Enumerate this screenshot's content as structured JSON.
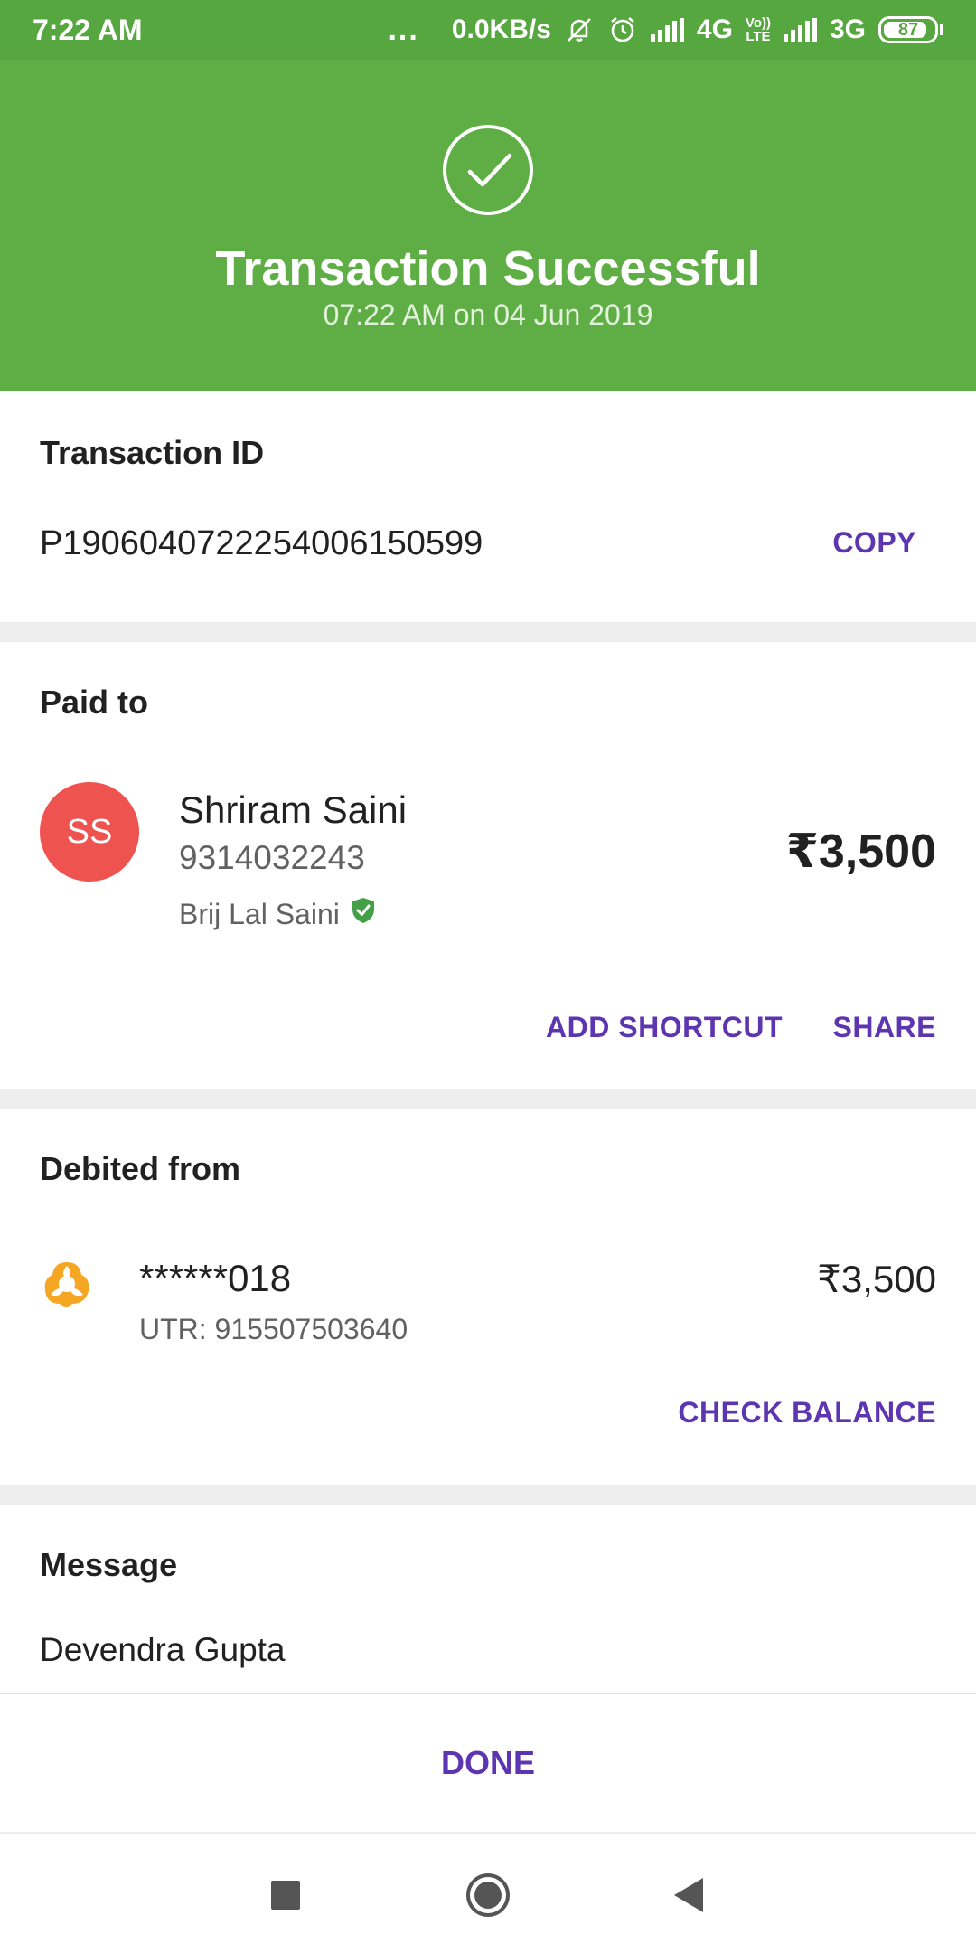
{
  "status_bar": {
    "time": "7:22 AM",
    "dots": "...",
    "speed": "0.0KB/s",
    "net1": "4G",
    "volte_top": "Vo))",
    "volte_bottom": "LTE",
    "net2": "3G",
    "battery": "87"
  },
  "header": {
    "title": "Transaction Successful",
    "subtitle": "07:22 AM on 04 Jun 2019",
    "bg_color": "#5fae45"
  },
  "transaction": {
    "label": "Transaction ID",
    "id": "P1906040722254006150599",
    "copy_label": "COPY"
  },
  "paid_to": {
    "label": "Paid to",
    "avatar_initials": "SS",
    "name": "Shriram Saini",
    "phone": "9314032243",
    "account_name": "Brij Lal Saini",
    "amount": "₹3,500",
    "add_shortcut_label": "ADD SHORTCUT",
    "share_label": "SHARE"
  },
  "debited_from": {
    "label": "Debited from",
    "account": "******018",
    "utr": "UTR: 915507503640",
    "amount": "₹3,500",
    "check_balance_label": "CHECK BALANCE"
  },
  "message": {
    "label": "Message",
    "text": "Devendra Gupta"
  },
  "done_label": "DONE",
  "colors": {
    "accent": "#5e35b1",
    "success": "#5fae45",
    "avatar": "#ef5350",
    "bank": "#f5a623"
  }
}
